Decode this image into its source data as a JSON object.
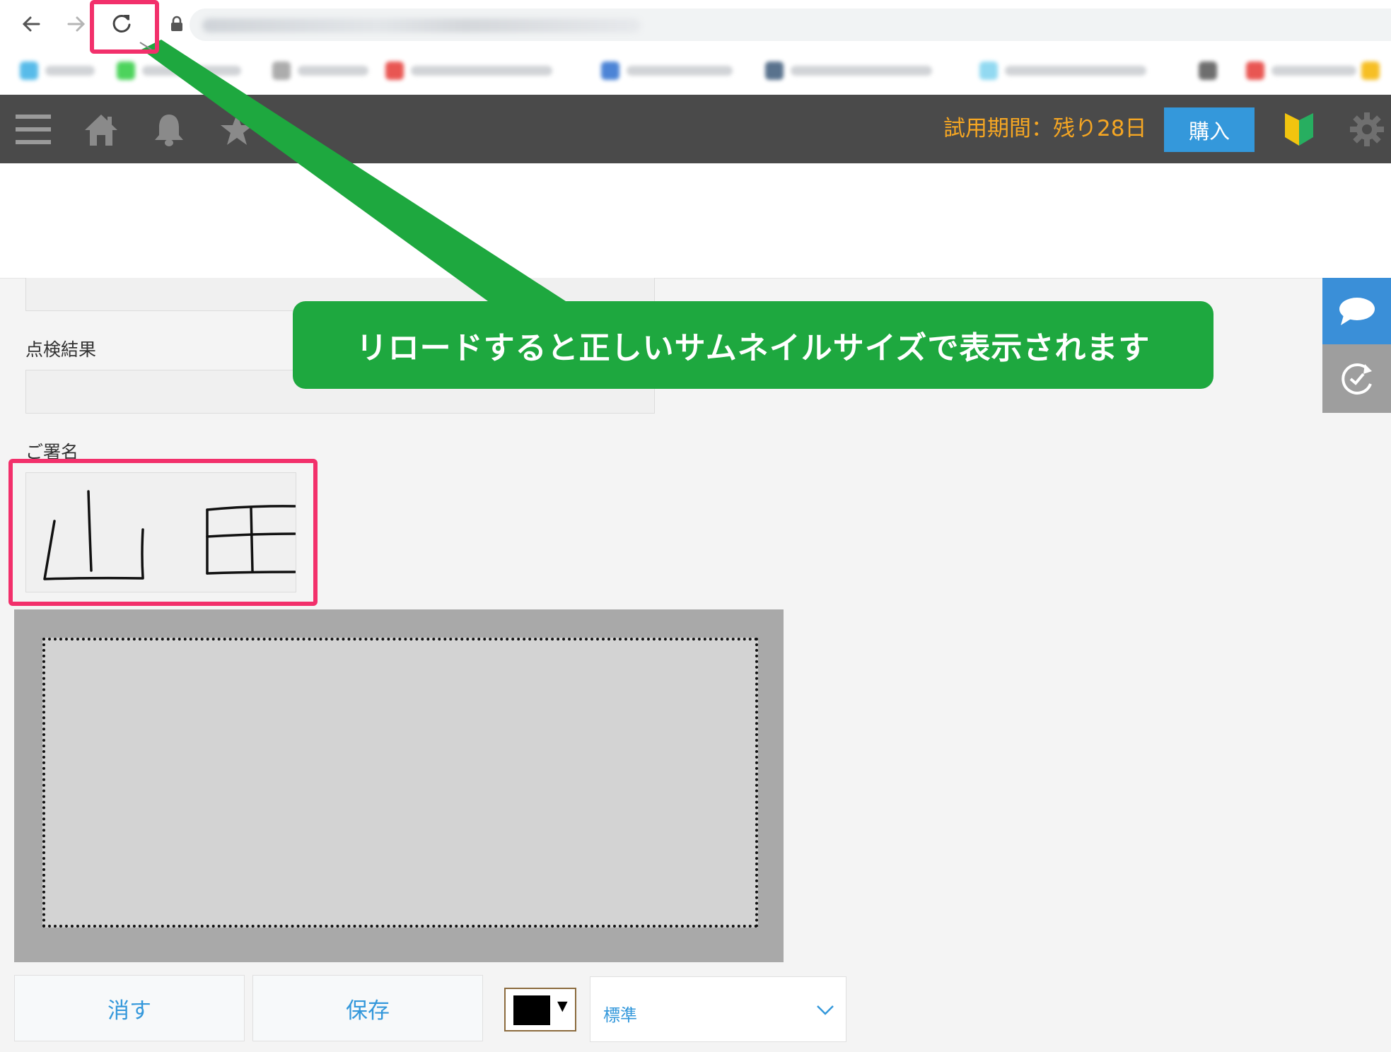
{
  "browser": {
    "icons": {
      "back": "arrow-left-icon",
      "forward": "arrow-right-icon",
      "reload": "reload-icon",
      "lock": "lock-icon"
    }
  },
  "header": {
    "trial_text": "試用期間：残り28日",
    "buy_label": "購入",
    "icons": [
      "menu-icon",
      "home-icon",
      "bell-icon",
      "star-icon",
      "beginner-mark-icon",
      "gear-icon"
    ],
    "colors": {
      "background": "#4a4a4a",
      "trial": "#f5a623",
      "buy": "#3498db"
    }
  },
  "form": {
    "inspection_result_label": "点検結果",
    "signature_label": "ご署名",
    "signature_thumbnail": "山 田"
  },
  "signature_tools": {
    "erase_label": "消す",
    "save_label": "保存",
    "pen_color": "#000000",
    "pen_size": "標準"
  },
  "side_buttons": [
    "comment-icon",
    "history-icon"
  ],
  "annotation": {
    "callout_text": "リロードすると正しいサムネイルサイズで表示されます",
    "colors": {
      "callout": "#1ea83f",
      "highlight": "#f2306b"
    }
  }
}
